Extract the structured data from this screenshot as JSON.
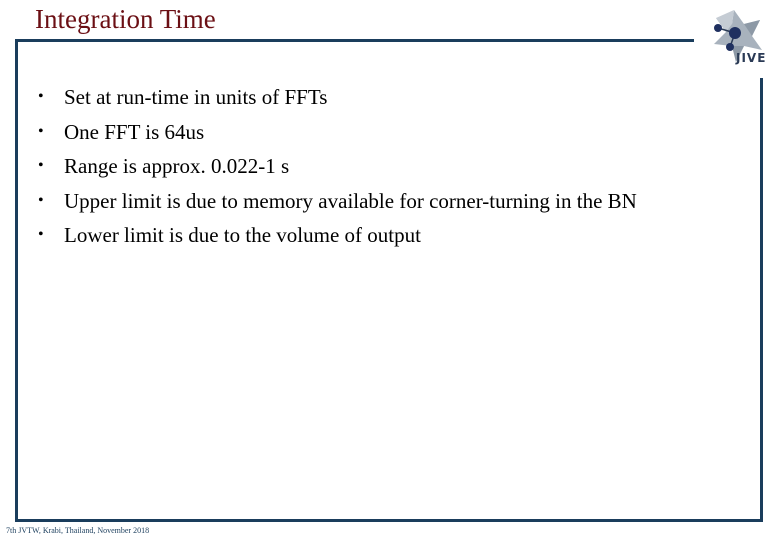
{
  "slide": {
    "title": "Integration Time",
    "logo_text": "JIVE",
    "bullets": [
      "Set at run-time in units of FFTs",
      "One FFT is 64us",
      "Range is approx. 0.022-1 s",
      "Upper limit is due to memory available for corner-turning in the BN",
      "Lower limit is due to the volume of output"
    ],
    "bullet_glyph": "•",
    "footer": "7th JVTW, Krabi, Thailand, November 2018"
  },
  "colors": {
    "title": "#6b0f14",
    "frame": "#1a3d5c"
  }
}
